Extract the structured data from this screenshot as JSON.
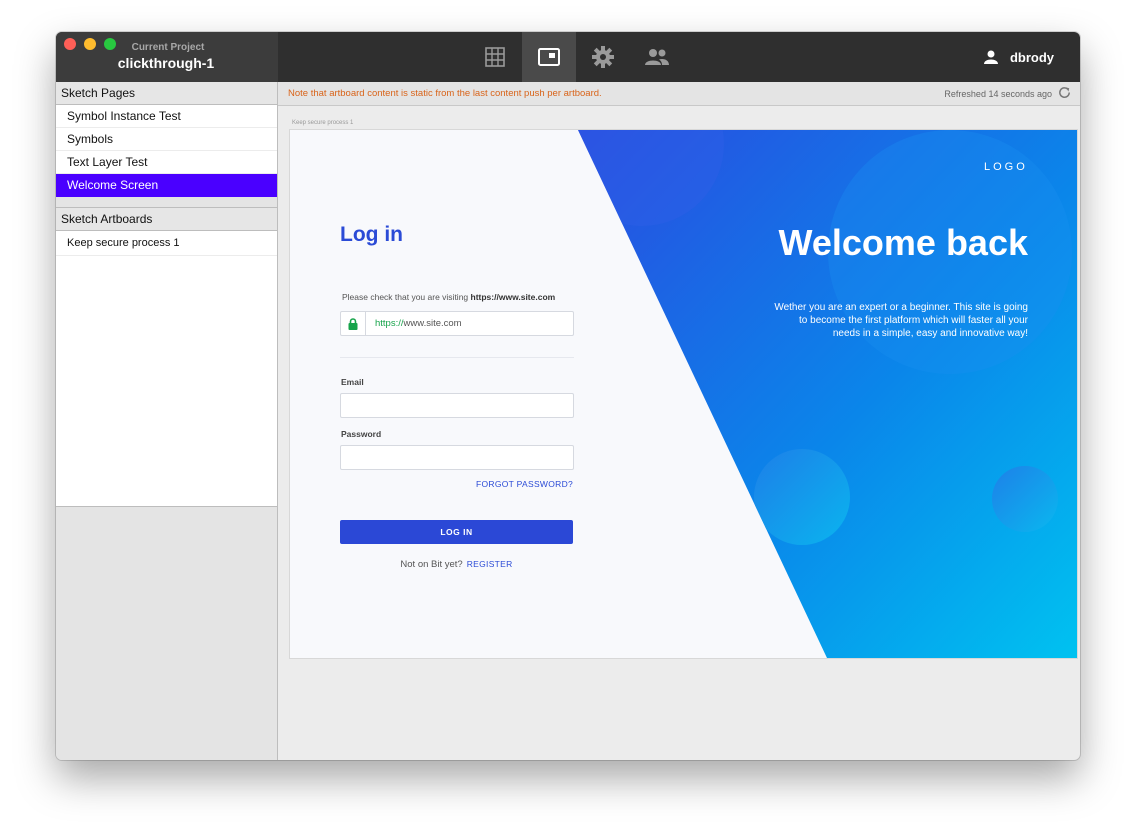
{
  "window": {
    "project_label": "Current Project",
    "project_name": "clickthrough-1"
  },
  "toolbar": {
    "buttons": [
      {
        "icon": "grid-icon"
      },
      {
        "icon": "artboard-preview-icon",
        "active": true
      },
      {
        "icon": "gear-icon"
      },
      {
        "icon": "users-icon"
      }
    ],
    "user_name": "dbrody"
  },
  "sidebar": {
    "pages_header": "Sketch Pages",
    "pages": [
      {
        "label": "Symbol Instance Test"
      },
      {
        "label": "Symbols"
      },
      {
        "label": "Text Layer Test"
      },
      {
        "label": "Welcome Screen",
        "selected": true
      }
    ],
    "artboards_header": "Sketch Artboards",
    "artboards": [
      {
        "label": "Keep secure process 1"
      }
    ]
  },
  "notice": {
    "text": "Note that artboard content is static from the last content push per artboard.",
    "refreshed": "Refreshed 14 seconds ago",
    "color": "#d9641a"
  },
  "artboard": {
    "label": "Keep secure process 1",
    "login": {
      "title": "Log in",
      "check_prefix": "Please check that you are visiting ",
      "check_url": "https://www.site.com",
      "url_protocol": "https://",
      "url_rest": "www.site.com",
      "email_label": "Email",
      "password_label": "Password",
      "forgot": "FORGOT PASSWORD?",
      "button": "LOG IN",
      "not_on": "Not on Bit yet?",
      "register": "REGISTER"
    },
    "hero": {
      "logo": "LOGO",
      "title": "Welcome back",
      "description": "Wether you are an expert or a beginner. This site is going to become the first platform which will faster all your needs in a simple, easy and innovative way!"
    },
    "colors": {
      "accent": "#2b4bd6",
      "gradient_start": "#2a4be0",
      "gradient_end": "#00c2f0",
      "selection": "#4a00ff"
    }
  }
}
